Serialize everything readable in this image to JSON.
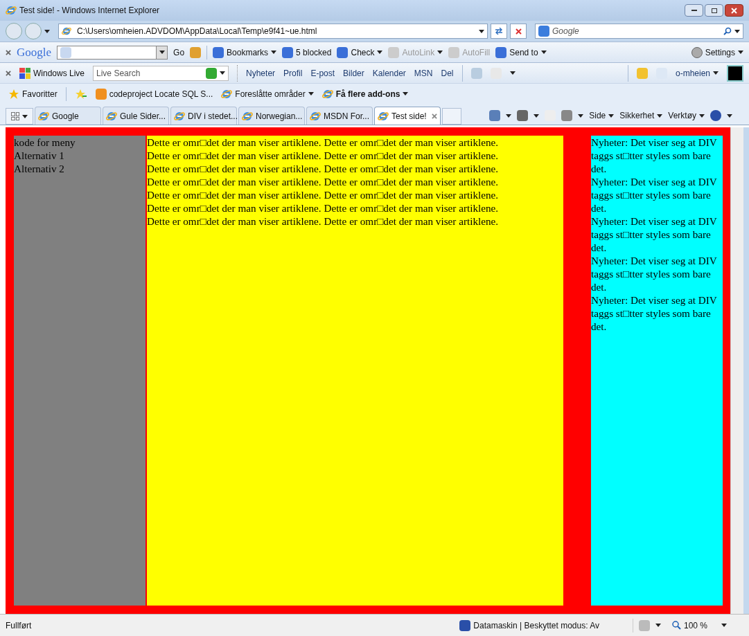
{
  "window": {
    "title": "Test side! - Windows Internet Explorer"
  },
  "address_bar": {
    "url": "C:\\Users\\omheien.ADVDOM\\AppData\\Local\\Temp\\e9f41~ue.html"
  },
  "search_box": {
    "placeholder": "Google"
  },
  "google_toolbar": {
    "brand": "Google",
    "items": [
      {
        "label": "Go",
        "disabled": false,
        "dropdown": false
      },
      {
        "label": "Bookmarks",
        "disabled": false,
        "dropdown": true
      },
      {
        "label": "5 blocked",
        "disabled": false,
        "dropdown": false
      },
      {
        "label": "Check",
        "disabled": false,
        "dropdown": true
      },
      {
        "label": "AutoLink",
        "disabled": true,
        "dropdown": true
      },
      {
        "label": "AutoFill",
        "disabled": true,
        "dropdown": false
      },
      {
        "label": "Send to",
        "disabled": false,
        "dropdown": true
      }
    ],
    "settings": "Settings"
  },
  "live_toolbar": {
    "brand": "Windows Live",
    "search_placeholder": "Live Search",
    "links": [
      "Nyheter",
      "Profil",
      "E-post",
      "Bilder",
      "Kalender",
      "MSN",
      "Del"
    ],
    "user": "o-mheien"
  },
  "favorites_bar": {
    "label": "Favoritter",
    "items": [
      {
        "label": "codeproject Locate SQL S...",
        "bold": false,
        "dropdown": false
      },
      {
        "label": "Foreslåtte områder",
        "bold": false,
        "dropdown": true
      },
      {
        "label": "Få flere add-ons",
        "bold": true,
        "dropdown": true
      }
    ]
  },
  "tabs": [
    {
      "label": "Google",
      "selected": false
    },
    {
      "label": "Gule Sider...",
      "selected": false
    },
    {
      "label": "DIV i stedet...",
      "selected": false
    },
    {
      "label": "Norwegian...",
      "selected": false
    },
    {
      "label": "MSDN For...",
      "selected": false
    },
    {
      "label": "Test side!",
      "selected": true
    }
  ],
  "command_bar": [
    "Side",
    "Sikkerhet",
    "Verktøy"
  ],
  "page": {
    "menu": [
      "kode for meny",
      "Alternativ 1",
      "Alternativ 2"
    ],
    "article_lines": [
      "Dette er omr□det der man viser artiklene. Dette er omr□det der man viser artiklene.",
      "Dette er omr□det der man viser artiklene. Dette er omr□det der man viser artiklene.",
      "Dette er omr□det der man viser artiklene. Dette er omr□det der man viser artiklene.",
      "Dette er omr□det der man viser artiklene. Dette er omr□det der man viser artiklene.",
      "Dette er omr□det der man viser artiklene. Dette er omr□det der man viser artiklene.",
      "Dette er omr□det der man viser artiklene. Dette er omr□det der man viser artiklene.",
      "Dette er omr□det der man viser artiklene. Dette er omr□det der man viser artiklene."
    ],
    "news": [
      "Nyheter: Det viser seg at DIV taggs st□tter styles som bare det.",
      "Nyheter: Det viser seg at DIV taggs st□tter styles som bare det.",
      "Nyheter: Det viser seg at DIV taggs st□tter styles som bare det.",
      "Nyheter: Det viser seg at DIV taggs st□tter styles som bare det.",
      "Nyheter: Det viser seg at DIV taggs st□tter styles som bare det."
    ]
  },
  "status_bar": {
    "status": "Fullført",
    "zone": "Datamaskin | Beskyttet modus: Av",
    "zoom": "100 %"
  }
}
